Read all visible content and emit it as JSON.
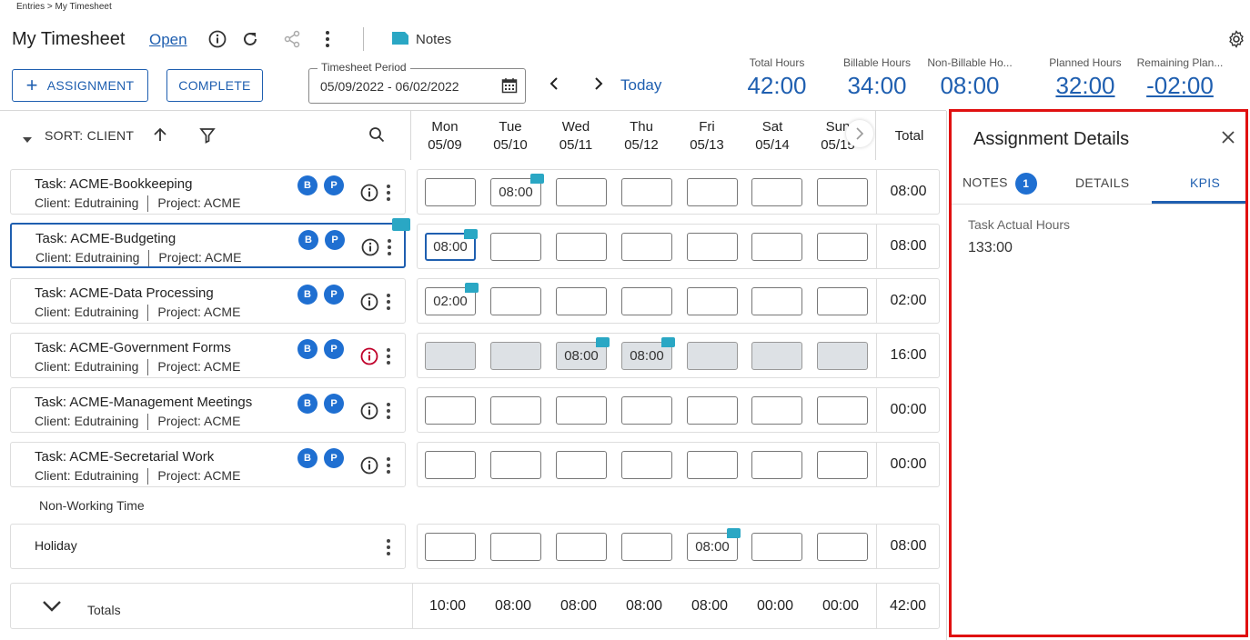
{
  "breadcrumb": "Entries > My Timesheet",
  "header": {
    "title": "My Timesheet",
    "status": "Open",
    "notes_label": "Notes",
    "assignment_button": "ASSIGNMENT",
    "complete_button": "COMPLETE",
    "period_label": "Timesheet Period",
    "period_value": "05/09/2022 - 06/02/2022",
    "today_label": "Today"
  },
  "stats": [
    {
      "label": "Total Hours",
      "value": "42:00"
    },
    {
      "label": "Billable Hours",
      "value": "34:00"
    },
    {
      "label": "Non-Billable Ho...",
      "value": "08:00"
    },
    {
      "label": "Planned Hours",
      "value": "32:00"
    },
    {
      "label": "Remaining Plan...",
      "value": "-02:00"
    }
  ],
  "grid": {
    "sort_label": "SORT: CLIENT",
    "days": [
      {
        "name": "Mon",
        "date": "05/09"
      },
      {
        "name": "Tue",
        "date": "05/10"
      },
      {
        "name": "Wed",
        "date": "05/11"
      },
      {
        "name": "Thu",
        "date": "05/12"
      },
      {
        "name": "Fri",
        "date": "05/13"
      },
      {
        "name": "Sat",
        "date": "05/14"
      },
      {
        "name": "Sun",
        "date": "05/15"
      }
    ],
    "total_header": "Total",
    "rows": [
      {
        "task": "Task: ACME-Bookkeeping",
        "client": "Client: Edutraining",
        "project": "Project: ACME",
        "cells": [
          "",
          "08:00",
          "",
          "",
          "",
          "",
          ""
        ],
        "total": "08:00"
      },
      {
        "task": "Task: ACME-Budgeting",
        "client": "Client: Edutraining",
        "project": "Project: ACME",
        "cells": [
          "08:00",
          "",
          "",
          "",
          "",
          "",
          ""
        ],
        "total": "08:00"
      },
      {
        "task": "Task: ACME-Data Processing",
        "client": "Client: Edutraining",
        "project": "Project: ACME",
        "cells": [
          "02:00",
          "",
          "",
          "",
          "",
          "",
          ""
        ],
        "total": "02:00"
      },
      {
        "task": "Task: ACME-Government Forms",
        "client": "Client: Edutraining",
        "project": "Project: ACME",
        "cells": [
          "",
          "",
          "08:00",
          "08:00",
          "",
          "",
          ""
        ],
        "total": "16:00"
      },
      {
        "task": "Task: ACME-Management Meetings",
        "client": "Client: Edutraining",
        "project": "Project: ACME",
        "cells": [
          "",
          "",
          "",
          "",
          "",
          "",
          ""
        ],
        "total": "00:00"
      },
      {
        "task": "Task: ACME-Secretarial Work",
        "client": "Client: Edutraining",
        "project": "Project: ACME",
        "cells": [
          "",
          "",
          "",
          "",
          "",
          "",
          ""
        ],
        "total": "00:00"
      }
    ],
    "badge_b": "B",
    "badge_p": "P",
    "non_working_label": "Non-Working Time",
    "holiday": {
      "label": "Holiday",
      "cells": [
        "",
        "",
        "",
        "",
        "08:00",
        "",
        ""
      ],
      "total": "08:00"
    },
    "totals_label": "Totals",
    "totals": [
      "10:00",
      "08:00",
      "08:00",
      "08:00",
      "08:00",
      "00:00",
      "00:00"
    ],
    "grand_total": "42:00"
  },
  "panel": {
    "title": "Assignment Details",
    "tabs": [
      {
        "label": "NOTES",
        "badge": "1"
      },
      {
        "label": "DETAILS"
      },
      {
        "label": "KPIS"
      }
    ],
    "kpi_label": "Task Actual Hours",
    "kpi_value": "133:00"
  },
  "colors": {
    "accent": "#1f5fb0",
    "flag": "#2aa7c4",
    "badge": "#1f6fd1",
    "highlight_border": "#e01010",
    "warning_icon": "#c0002a"
  }
}
